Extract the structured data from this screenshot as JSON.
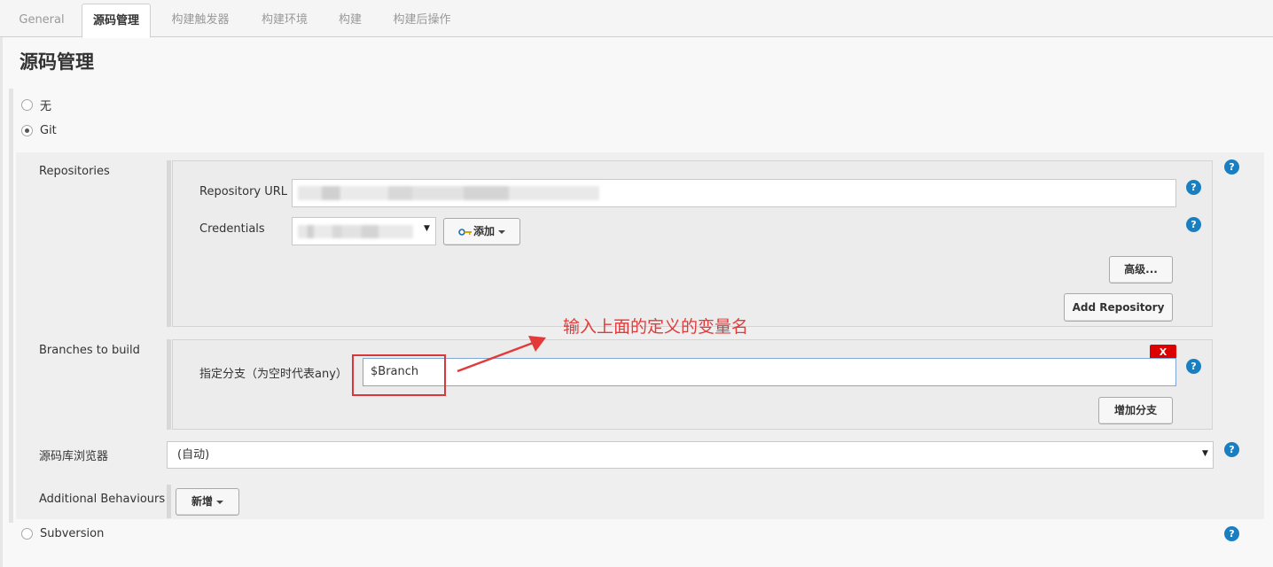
{
  "tabs": [
    {
      "label": "General",
      "active": false
    },
    {
      "label": "源码管理",
      "active": true
    },
    {
      "label": "构建触发器",
      "active": false
    },
    {
      "label": "构建环境",
      "active": false
    },
    {
      "label": "构建",
      "active": false
    },
    {
      "label": "构建后操作",
      "active": false
    }
  ],
  "page_title": "源码管理",
  "scm_options": {
    "none": "无",
    "git": "Git",
    "subversion": "Subversion",
    "selected": "Git"
  },
  "repositories": {
    "section_label": "Repositories",
    "url_label": "Repository URL",
    "credentials_label": "Credentials",
    "add_credentials_button": "添加",
    "advanced_button": "高级...",
    "add_repository_button": "Add Repository"
  },
  "branches": {
    "section_label": "Branches to build",
    "specifier_label": "指定分支（为空时代表any）",
    "specifier_value": "$Branch",
    "delete_button": "X",
    "add_branch_button": "增加分支"
  },
  "browser": {
    "label": "源码库浏览器",
    "selected": "(自动)"
  },
  "behaviours": {
    "label": "Additional Behaviours",
    "add_button": "新增"
  },
  "help_glyph": "?",
  "annotation": {
    "text": "输入上面的定义的变量名",
    "color": "#e23a3a"
  },
  "colors": {
    "help_icon": "#1a7fc1",
    "delete_button": "#dd0000",
    "annotation": "#d93838"
  }
}
